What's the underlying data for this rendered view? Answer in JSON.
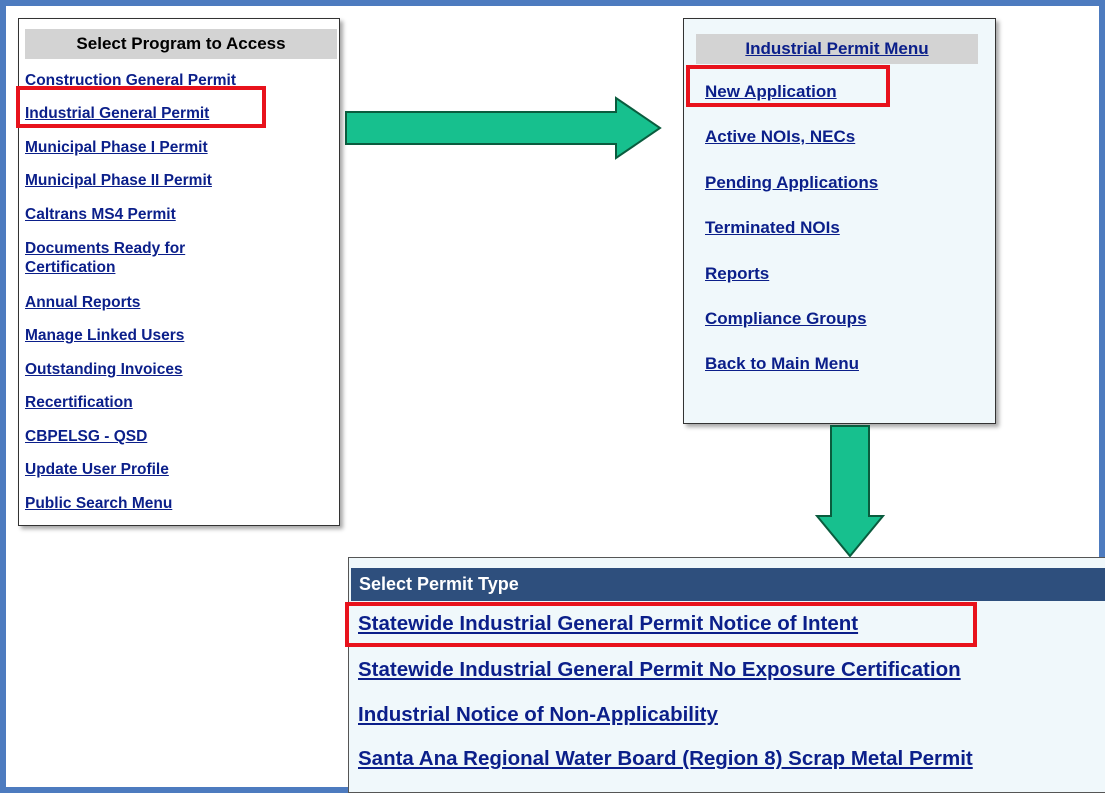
{
  "program_panel": {
    "header": "Select Program to Access",
    "items": [
      "Construction General Permit",
      "Industrial General Permit",
      "Municipal Phase I Permit",
      "Municipal Phase II Permit",
      "Caltrans MS4 Permit",
      "Documents Ready for",
      "Certification",
      "Annual Reports",
      "Manage Linked Users",
      "Outstanding Invoices",
      "Recertification",
      "CBPELSG - QSD",
      "Update User Profile",
      "Public Search Menu"
    ]
  },
  "industrial_menu": {
    "header": "Industrial Permit Menu",
    "items": [
      "New Application",
      "Active NOIs, NECs",
      "Pending Applications",
      "Terminated NOIs",
      "Reports",
      "Compliance Groups",
      "Back to Main Menu"
    ]
  },
  "permit_type": {
    "header": "Select Permit Type",
    "items": [
      "Statewide Industrial General Permit Notice of Intent",
      "Statewide Industrial General Permit No Exposure Certification",
      "Industrial Notice of Non-Applicability",
      "Santa Ana Regional Water Board (Region 8) Scrap Metal Permit"
    ]
  },
  "colors": {
    "frame": "#4d7bbf",
    "link": "#0b1f8a",
    "highlight": "#e8121c",
    "arrow_fill": "#17c08e",
    "permit_header_bg": "#2e4f7d"
  },
  "icons": [
    "arrow-right-icon",
    "arrow-down-icon"
  ]
}
